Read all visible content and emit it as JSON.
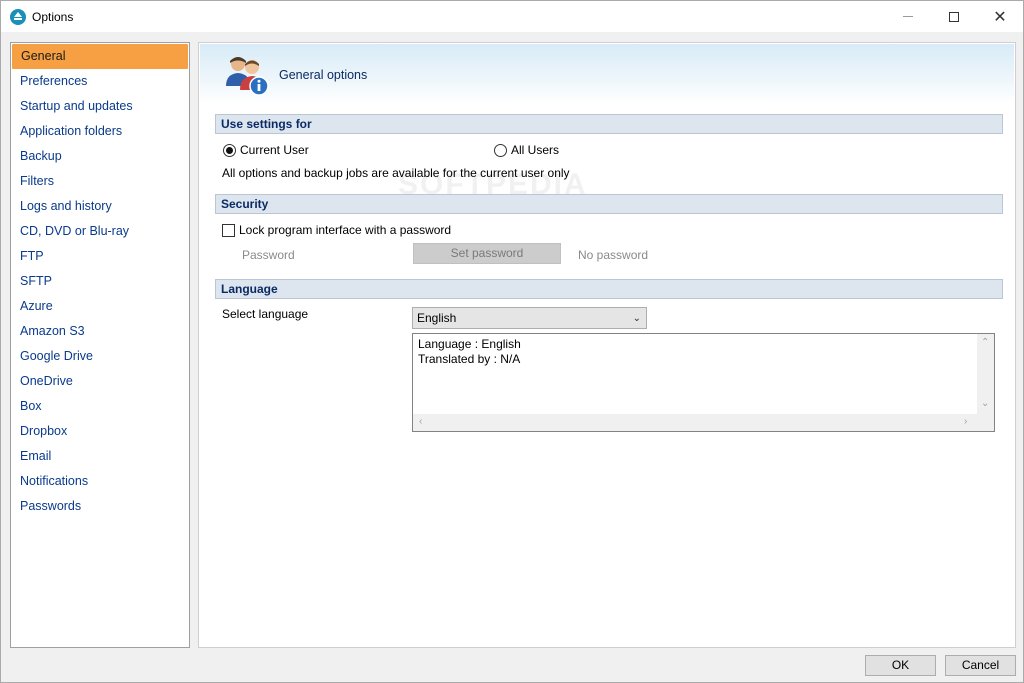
{
  "window": {
    "title": "Options"
  },
  "controls": {
    "minimize": "—",
    "maximize": "☐",
    "close": "✕"
  },
  "sidebar": {
    "items": [
      {
        "label": "General",
        "active": true
      },
      {
        "label": "Preferences"
      },
      {
        "label": "Startup and updates"
      },
      {
        "label": "Application folders"
      },
      {
        "label": "Backup"
      },
      {
        "label": "Filters"
      },
      {
        "label": "Logs and history"
      },
      {
        "label": "CD, DVD or Blu-ray"
      },
      {
        "label": "FTP"
      },
      {
        "label": "SFTP"
      },
      {
        "label": "Azure"
      },
      {
        "label": "Amazon S3"
      },
      {
        "label": "Google Drive"
      },
      {
        "label": "OneDrive"
      },
      {
        "label": "Box"
      },
      {
        "label": "Dropbox"
      },
      {
        "label": "Email"
      },
      {
        "label": "Notifications"
      },
      {
        "label": "Passwords"
      }
    ]
  },
  "header": {
    "title": "General options",
    "icon": "users-info-icon"
  },
  "use_settings": {
    "section_label": "Use settings for",
    "current_user": "Current User",
    "all_users": "All Users",
    "selected": "current_user",
    "description": "All options and backup jobs are available for the current user only"
  },
  "security": {
    "section_label": "Security",
    "lock_label": "Lock program interface with a password",
    "lock_checked": false,
    "password_label": "Password",
    "set_password_button": "Set password",
    "status": "No password"
  },
  "language": {
    "section_label": "Language",
    "select_label": "Select language",
    "selected_value": "English",
    "info_line1": "Language : English",
    "info_line2": "Translated by : N/A"
  },
  "footer": {
    "ok": "OK",
    "cancel": "Cancel"
  },
  "colors": {
    "active_nav": "#f7a043",
    "nav_text": "#0a3a8c",
    "section_bg": "#dde6ee"
  }
}
